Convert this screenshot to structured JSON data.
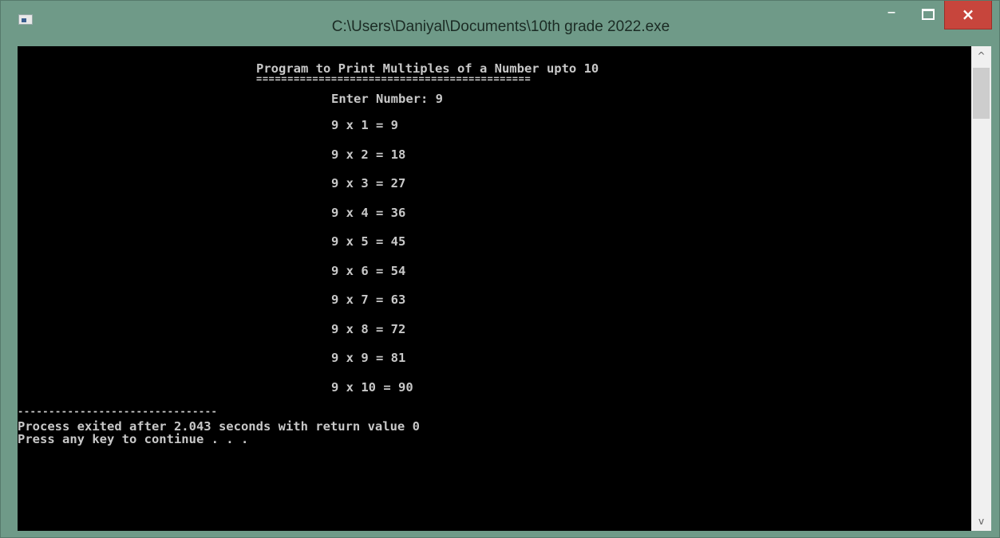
{
  "window": {
    "title": "C:\\Users\\Daniyal\\Documents\\10th grade 2022.exe",
    "controls": {
      "minimize": "–",
      "close": "×"
    },
    "icons": [
      "console-app-icon",
      "minimize-icon",
      "maximize-icon",
      "close-icon",
      "chevron-up-icon",
      "chevron-down-icon"
    ]
  },
  "console": {
    "heading": "Program to Print Multiples of a Number upto 10",
    "underline": "============================================",
    "prompt": "Enter Number: 9",
    "rows": [
      "9 x 1 = 9",
      "9 x 2 = 18",
      "9 x 3 = 27",
      "9 x 4 = 36",
      "9 x 5 = 45",
      "9 x 6 = 54",
      "9 x 7 = 63",
      "9 x 8 = 72",
      "9 x 9 = 81",
      "9 x 10 = 90"
    ],
    "separator": "--------------------------------",
    "exit_message": "Process exited after 2.043 seconds with return value 0",
    "continue_message": "Press any key to continue . . ."
  },
  "scrollbar": {
    "up": "^",
    "down": "v"
  }
}
